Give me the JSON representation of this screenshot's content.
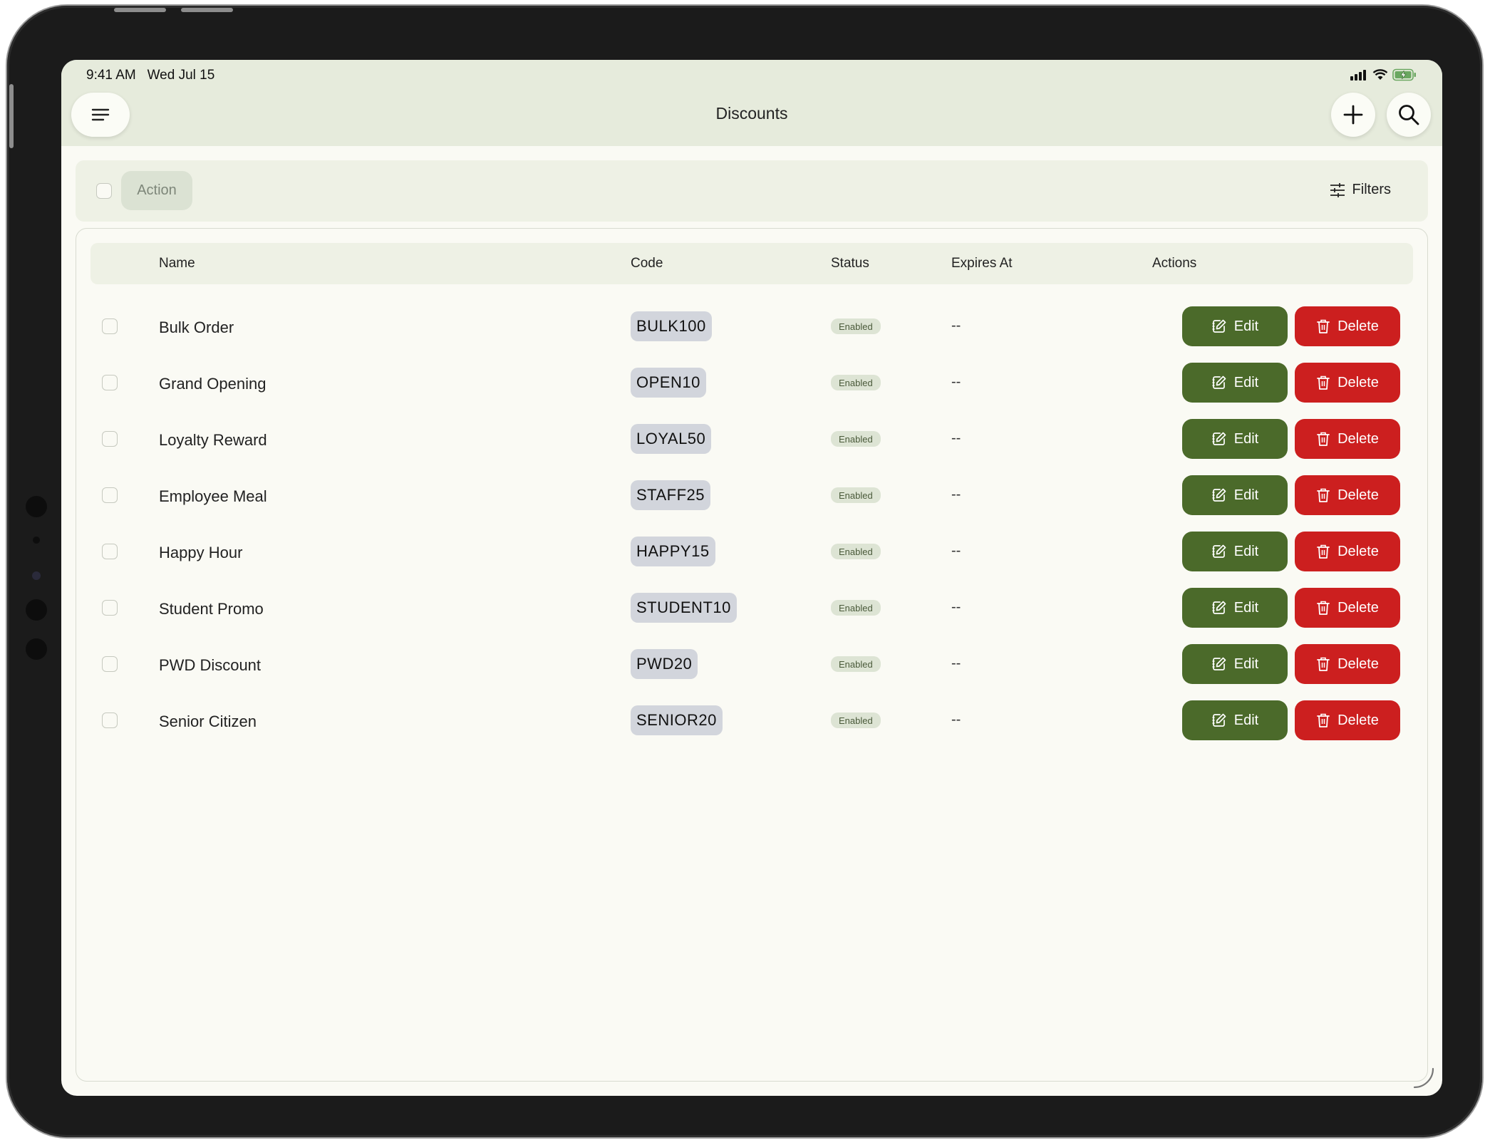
{
  "status_bar": {
    "time": "9:41 AM",
    "date": "Wed Jul 15"
  },
  "header": {
    "title": "Discounts",
    "menu_icon": "hamburger-icon",
    "add_icon": "plus-icon",
    "search_icon": "search-icon"
  },
  "toolbar": {
    "action_label": "Action",
    "filters_label": "Filters"
  },
  "table": {
    "columns": [
      "Name",
      "Code",
      "Status",
      "Expires At",
      "Actions"
    ],
    "edit_label": "Edit",
    "delete_label": "Delete",
    "rows": [
      {
        "name": "Bulk Order",
        "code": "BULK100",
        "status": "Enabled",
        "expires": "--"
      },
      {
        "name": "Grand Opening",
        "code": "OPEN10",
        "status": "Enabled",
        "expires": "--"
      },
      {
        "name": "Loyalty Reward",
        "code": "LOYAL50",
        "status": "Enabled",
        "expires": "--"
      },
      {
        "name": "Employee Meal",
        "code": "STAFF25",
        "status": "Enabled",
        "expires": "--"
      },
      {
        "name": "Happy Hour",
        "code": "HAPPY15",
        "status": "Enabled",
        "expires": "--"
      },
      {
        "name": "Student Promo",
        "code": "STUDENT10",
        "status": "Enabled",
        "expires": "--"
      },
      {
        "name": "PWD Discount",
        "code": "PWD20",
        "status": "Enabled",
        "expires": "--"
      },
      {
        "name": "Senior Citizen",
        "code": "SENIOR20",
        "status": "Enabled",
        "expires": "--"
      }
    ]
  },
  "colors": {
    "header_bg": "#e6ebdc",
    "edit": "#4b6a2a",
    "delete": "#cc1f1f",
    "screen_bg": "#fafaf4"
  }
}
